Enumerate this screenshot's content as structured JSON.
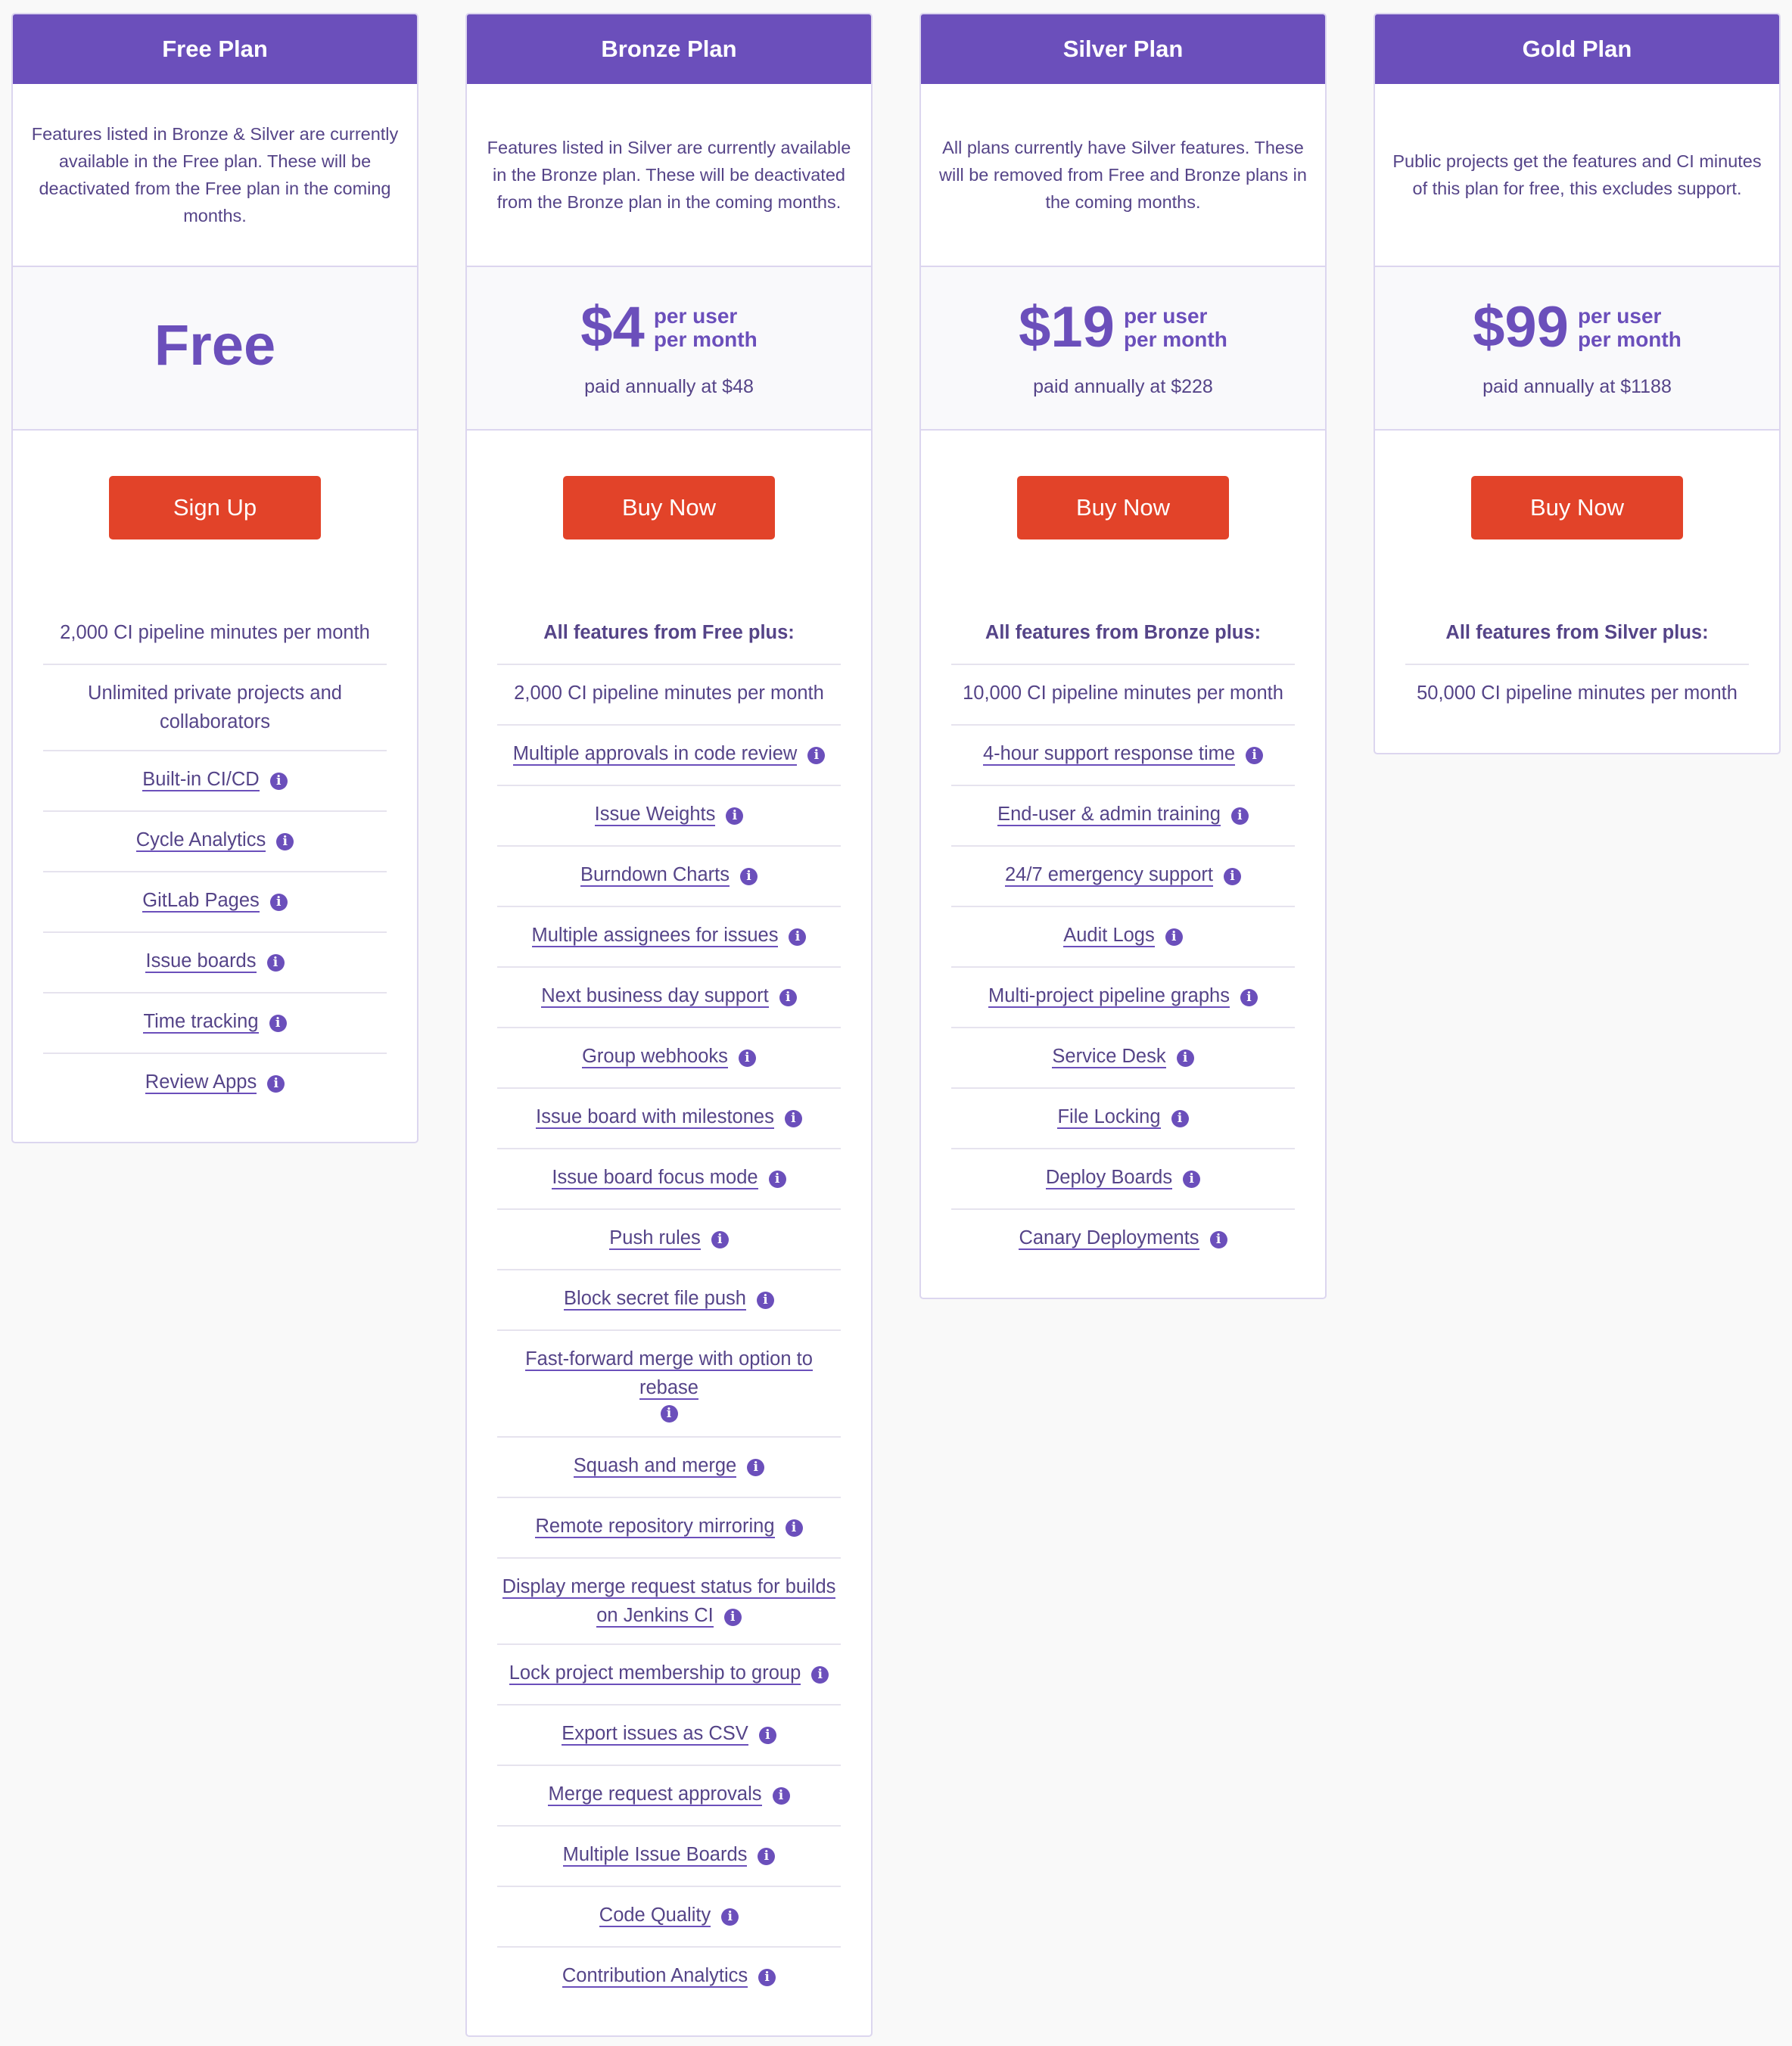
{
  "colors": {
    "header_bg": "#6b4fbb",
    "accent": "#6b4fbb",
    "text": "#554488",
    "cta": "#e24329",
    "page_bg": "#f9f9f9"
  },
  "plans": [
    {
      "title": "Free Plan",
      "description": "Features listed in Bronze & Silver are currently available in the Free plan. These will be deactivated from the Free plan in the coming months.",
      "price_label": "Free",
      "cta": "Sign Up",
      "features": [
        {
          "text": "2,000 CI pipeline minutes per month"
        },
        {
          "text": "Unlimited private projects and collaborators"
        },
        {
          "text": "Built-in CI/CD",
          "link": true,
          "icon": "info-icon"
        },
        {
          "text": "Cycle Analytics",
          "link": true,
          "icon": "info-icon"
        },
        {
          "text": "GitLab Pages",
          "link": true,
          "icon": "info-icon"
        },
        {
          "text": "Issue boards",
          "link": true,
          "icon": "info-icon"
        },
        {
          "text": "Time tracking",
          "link": true,
          "icon": "info-icon"
        },
        {
          "text": "Review Apps",
          "link": true,
          "icon": "info-icon"
        }
      ]
    },
    {
      "title": "Bronze Plan",
      "description": "Features listed in Silver are currently available in the Bronze plan. These will be deactivated from the Bronze plan in the coming months.",
      "price": "$4",
      "price_unit_1": "per user",
      "price_unit_2": "per month",
      "annual": "paid annually at $48",
      "cta": "Buy Now",
      "features": [
        {
          "text": "All features from Free plus:",
          "heading": true
        },
        {
          "text": "2,000 CI pipeline minutes per month"
        },
        {
          "text": "Multiple approvals in code review",
          "link": true,
          "icon": "info-icon"
        },
        {
          "text": "Issue Weights",
          "link": true,
          "icon": "info-icon"
        },
        {
          "text": "Burndown Charts",
          "link": true,
          "icon": "info-icon"
        },
        {
          "text": "Multiple assignees for issues",
          "link": true,
          "icon": "info-icon"
        },
        {
          "text": "Next business day support",
          "link": true,
          "icon": "info-icon"
        },
        {
          "text": "Group webhooks",
          "link": true,
          "icon": "info-icon"
        },
        {
          "text": "Issue board with milestones",
          "link": true,
          "icon": "info-icon"
        },
        {
          "text": "Issue board focus mode",
          "link": true,
          "icon": "info-icon"
        },
        {
          "text": "Push rules",
          "link": true,
          "icon": "info-icon"
        },
        {
          "text": "Block secret file push",
          "link": true,
          "icon": "info-icon"
        },
        {
          "text": "Fast-forward merge with option to rebase",
          "link": true,
          "icon": "info-icon",
          "icon_block": true
        },
        {
          "text": "Squash and merge",
          "link": true,
          "icon": "info-icon"
        },
        {
          "text": "Remote repository mirroring",
          "link": true,
          "icon": "info-icon"
        },
        {
          "text": "Display merge request status for builds on Jenkins CI",
          "link": true,
          "icon": "info-icon"
        },
        {
          "text": "Lock project membership to group",
          "link": true,
          "icon": "info-icon"
        },
        {
          "text": "Export issues as CSV",
          "link": true,
          "icon": "info-icon"
        },
        {
          "text": "Merge request approvals",
          "link": true,
          "icon": "info-icon"
        },
        {
          "text": "Multiple Issue Boards",
          "link": true,
          "icon": "info-icon"
        },
        {
          "text": "Code Quality",
          "link": true,
          "icon": "info-icon"
        },
        {
          "text": "Contribution Analytics",
          "link": true,
          "icon": "info-icon"
        }
      ]
    },
    {
      "title": "Silver Plan",
      "description": "All plans currently have Silver features. These will be removed from Free and Bronze plans in the coming months.",
      "price": "$19",
      "price_unit_1": "per user",
      "price_unit_2": "per month",
      "annual": "paid annually at $228",
      "cta": "Buy Now",
      "features": [
        {
          "text": "All features from Bronze plus:",
          "heading": true
        },
        {
          "text": "10,000 CI pipeline minutes per month"
        },
        {
          "text": "4-hour support response time",
          "link": true,
          "icon": "info-icon"
        },
        {
          "text": "End-user & admin training",
          "link": true,
          "icon": "info-icon"
        },
        {
          "text": "24/7 emergency support",
          "link": true,
          "icon": "info-icon"
        },
        {
          "text": "Audit Logs",
          "link": true,
          "icon": "info-icon"
        },
        {
          "text": "Multi-project pipeline graphs",
          "link": true,
          "icon": "info-icon"
        },
        {
          "text": "Service Desk",
          "link": true,
          "icon": "info-icon"
        },
        {
          "text": "File Locking",
          "link": true,
          "icon": "info-icon"
        },
        {
          "text": "Deploy Boards",
          "link": true,
          "icon": "info-icon"
        },
        {
          "text": "Canary Deployments",
          "link": true,
          "icon": "info-icon"
        }
      ]
    },
    {
      "title": "Gold Plan",
      "description": "Public projects get the features and CI minutes of this plan for free, this excludes support.",
      "price": "$99",
      "price_unit_1": "per user",
      "price_unit_2": "per month",
      "annual": "paid annually at $1188",
      "cta": "Buy Now",
      "features": [
        {
          "text": "All features from Silver plus:",
          "heading": true
        },
        {
          "text": "50,000 CI pipeline minutes per month"
        }
      ]
    }
  ]
}
